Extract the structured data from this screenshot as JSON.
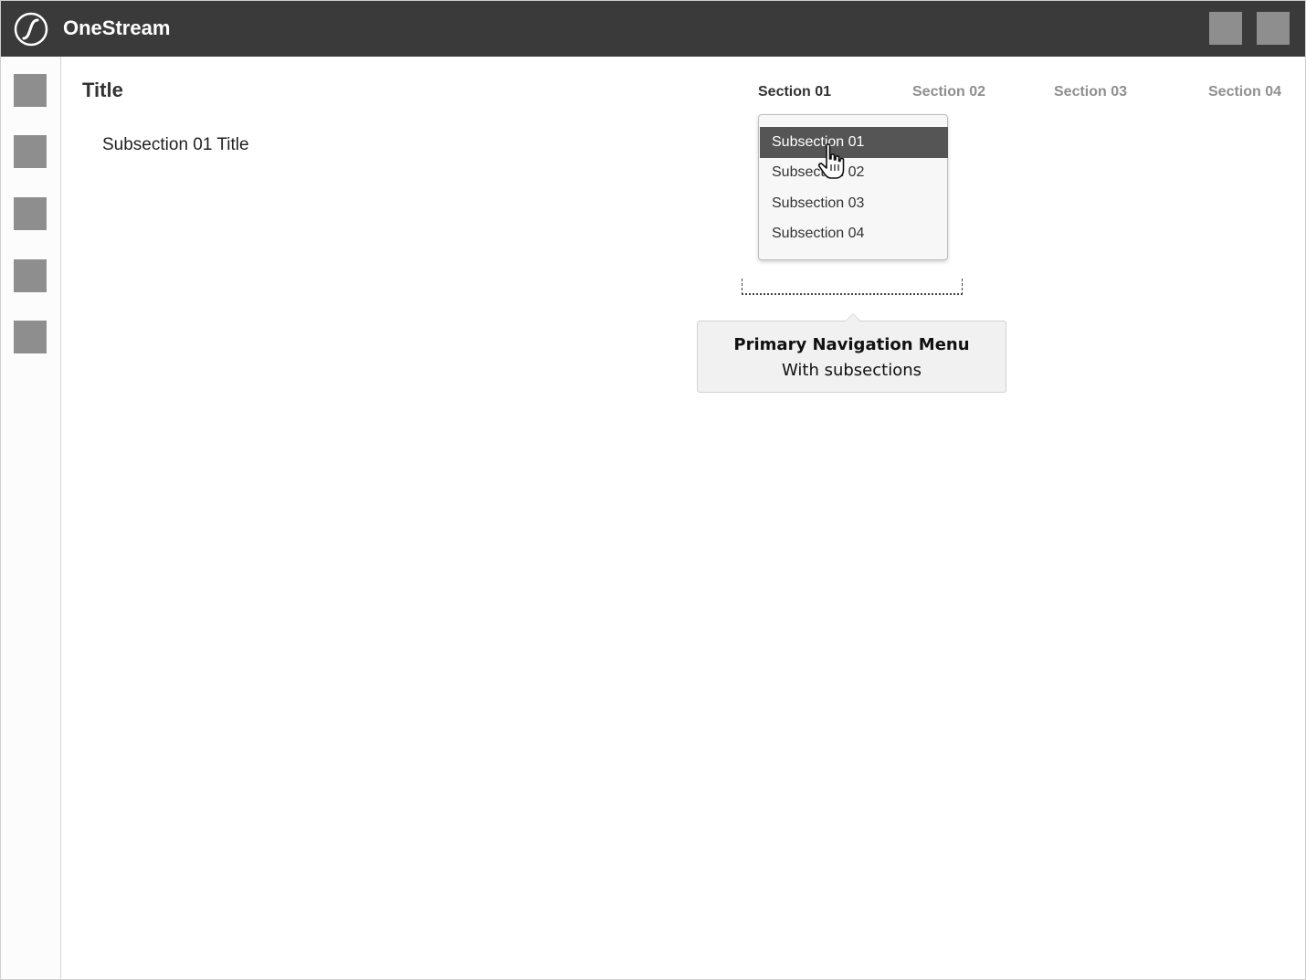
{
  "header": {
    "app_name": "OneStream",
    "logo_icon": "onestream-logo-icon",
    "background": "#3a3a3a",
    "buttons": [
      {
        "icon": "placeholder-square-icon"
      },
      {
        "icon": "placeholder-square-icon"
      }
    ]
  },
  "sidebar": {
    "items": [
      {
        "icon": "placeholder-square-icon"
      },
      {
        "icon": "placeholder-square-icon"
      },
      {
        "icon": "placeholder-square-icon"
      },
      {
        "icon": "placeholder-square-icon"
      },
      {
        "icon": "placeholder-square-icon"
      }
    ]
  },
  "main": {
    "title": "Title",
    "subsection_title": "Subsection 01 Title"
  },
  "nav": {
    "tabs": [
      {
        "label": "Section 01",
        "active": true
      },
      {
        "label": "Section 02",
        "active": false
      },
      {
        "label": "Section 03",
        "active": false
      },
      {
        "label": "Section 04",
        "active": false
      }
    ],
    "dropdown": {
      "items": [
        {
          "label": "Subsection 01",
          "selected": true
        },
        {
          "label": "Subsection 02",
          "selected": false
        },
        {
          "label": "Subsection 03",
          "selected": false
        },
        {
          "label": "Subsection 04",
          "selected": false
        }
      ]
    }
  },
  "callout": {
    "title": "Primary Navigation Menu",
    "subtitle": "With subsections"
  },
  "colors": {
    "topbar": "#3a3a3a",
    "placeholder": "#8e8e8e",
    "selected_item": "#555555",
    "inactive_tab": "#8f8f8f"
  }
}
